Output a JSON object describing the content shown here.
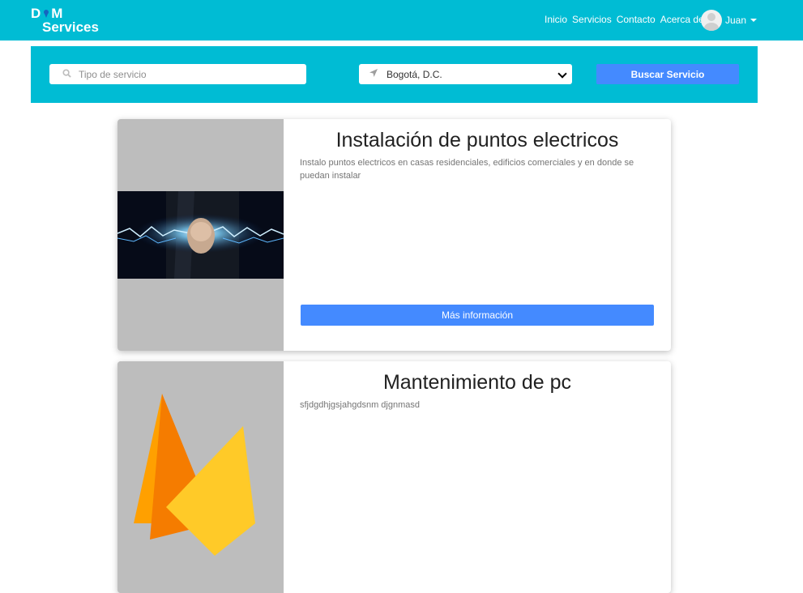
{
  "brand": {
    "line1_left": "D",
    "line1_right": "M",
    "line2": "Services"
  },
  "nav": {
    "items": [
      "Inicio",
      "Servicios",
      "Contacto",
      "Acerca de"
    ]
  },
  "user": {
    "name": "Juan"
  },
  "search": {
    "service_placeholder": "Tipo de servicio",
    "city_value": "Bogotá, D.C.",
    "button_label": "Buscar Servicio"
  },
  "cards": [
    {
      "title": "Instalación de puntos electricos",
      "description": "Instalo puntos electricos en casas residenciales, edificios comerciales y en donde se puedan instalar",
      "button_label": "Más información"
    },
    {
      "title": "Mantenimiento de pc",
      "description": "sfjdgdhjgsjahgdsnm djgnmasd"
    }
  ],
  "colors": {
    "primary": "#00bcd4",
    "button": "#448aff",
    "image_placeholder": "#bdbdbd"
  },
  "icons": {
    "search": "search-icon",
    "location": "location-arrow-icon",
    "chevron": "chevron-down-icon"
  }
}
